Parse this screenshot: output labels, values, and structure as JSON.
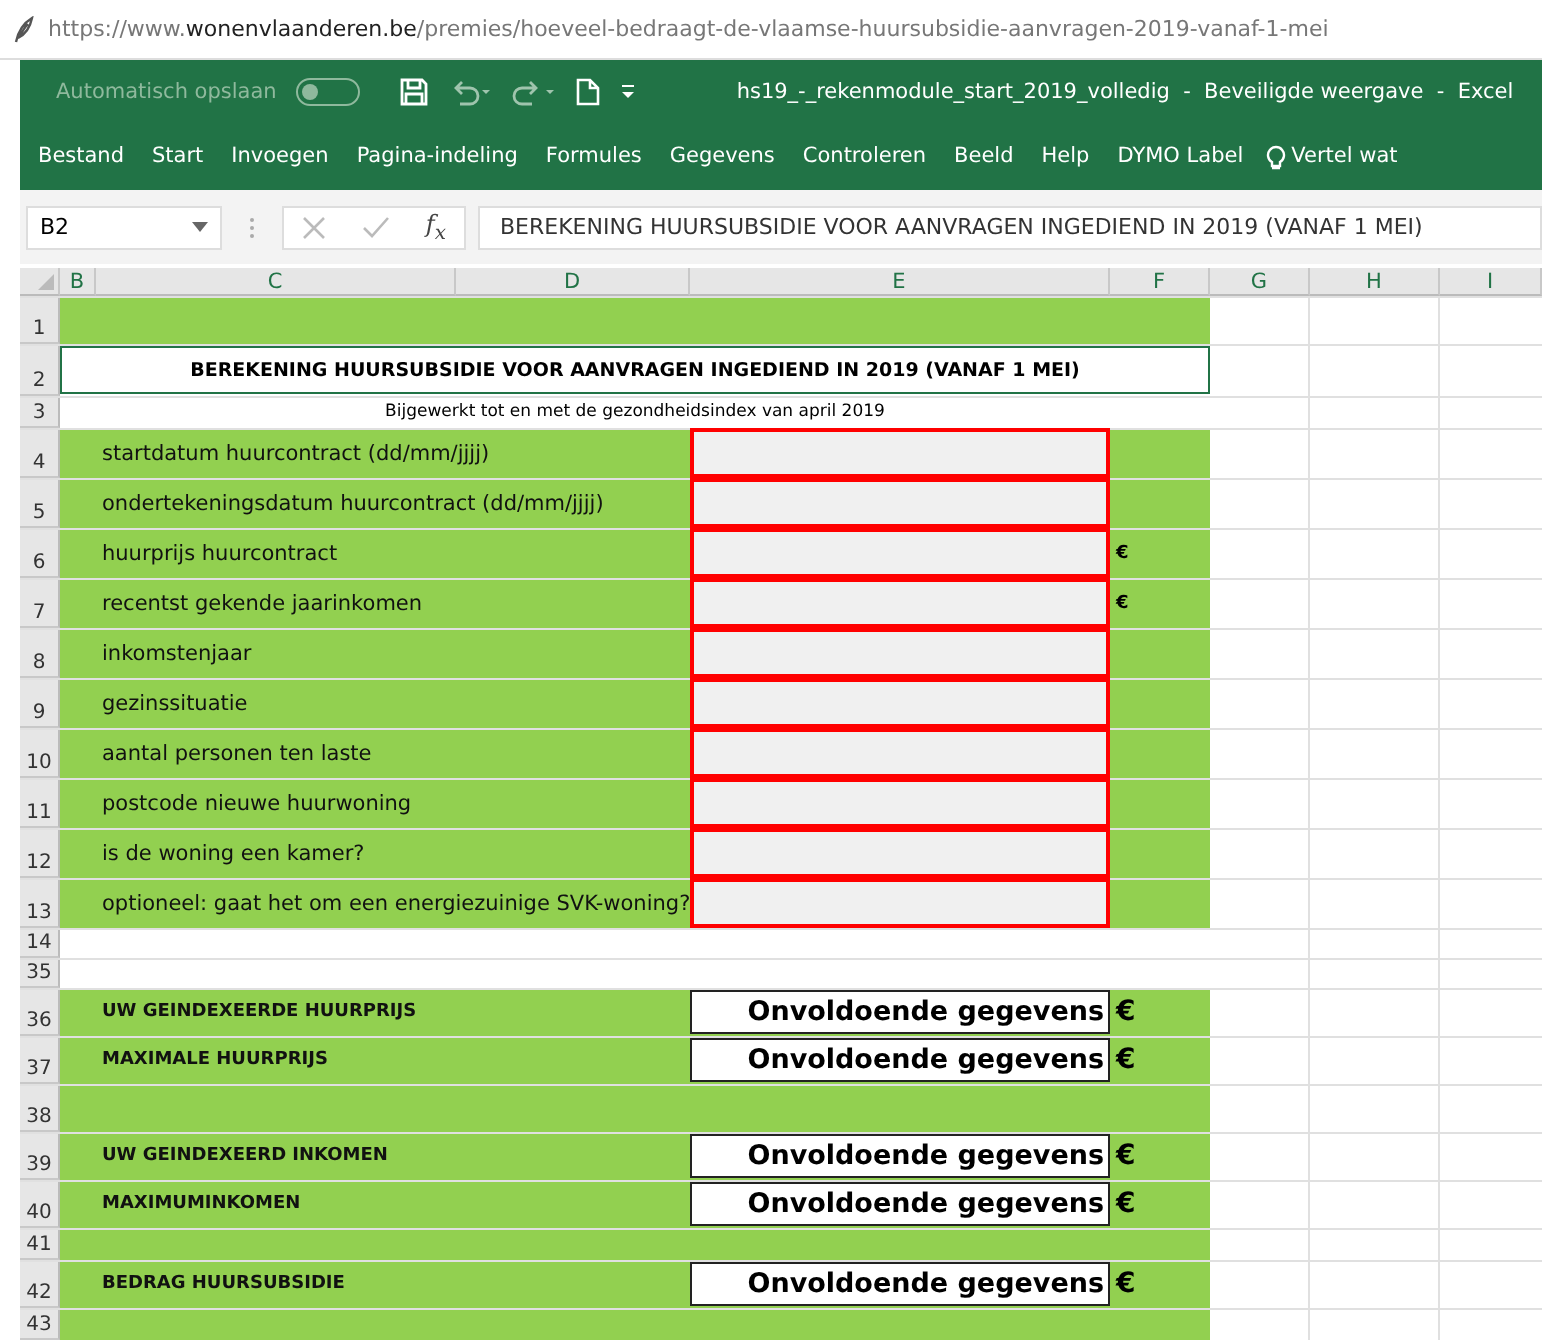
{
  "browser": {
    "url": "https://www.**wonenvlaanderen.be**/premies/hoeveel-bedraagt-de-vlaamse-huursubsidie-aanvragen-2019-vanaf-1-mei"
  },
  "excel": {
    "autosave_label": "Automatisch opslaan",
    "autosave_on": false,
    "title": "hs19_-_rekenmodule_start_2019_volledig  -  Beveiligde weergave  -  Excel",
    "menu": [
      "Bestand",
      "Start",
      "Invoegen",
      "Pagina-indeling",
      "Formules",
      "Gegevens",
      "Controleren",
      "Beeld",
      "Help",
      "DYMO Label"
    ],
    "tell_me": "Vertel wat"
  },
  "formula_bar": {
    "name_box": "B2",
    "fx": "f$_{x}$",
    "formula": "BEREKENING HUURSUBSIDIE VOOR AANVRAGEN INGEDIEND IN 2019 (VANAF 1 MEI)"
  },
  "columns": [
    "B",
    "C",
    "D",
    "E",
    "F",
    "G",
    "H",
    "I"
  ],
  "rows": [
    {
      "number": "1",
      "kind": "blank"
    },
    {
      "number": "2",
      "kind": "title",
      "text": "BEREKENING HUURSUBSIDIE VOOR AANVRAGEN INGEDIEND IN 2019 (VANAF 1 MEI)"
    },
    {
      "number": "3",
      "kind": "subtitle",
      "text": "Bijgewerkt tot en met de gezondheidsindex van april 2019"
    },
    {
      "number": "4",
      "kind": "input",
      "label": "startdatum huurcontract (dd/mm/jjjj)"
    },
    {
      "number": "5",
      "kind": "input",
      "label": "ondertekeningsdatum huurcontract (dd/mm/jjjj)"
    },
    {
      "number": "6",
      "kind": "input",
      "label": "huurprijs huurcontract",
      "unit": "€"
    },
    {
      "number": "7",
      "kind": "input",
      "label": "recentst gekende jaarinkomen",
      "unit": "€"
    },
    {
      "number": "8",
      "kind": "input",
      "label": "inkomstenjaar"
    },
    {
      "number": "9",
      "kind": "input",
      "label": "gezinssituatie"
    },
    {
      "number": "10",
      "kind": "input",
      "label": "aantal personen ten laste"
    },
    {
      "number": "11",
      "kind": "input",
      "label": "postcode nieuwe huurwoning"
    },
    {
      "number": "12",
      "kind": "input",
      "label": "is de woning een kamer?"
    },
    {
      "number": "13",
      "kind": "input",
      "label": "optioneel: gaat het om een energiezuinige SVK-woning?"
    },
    {
      "number": "14",
      "kind": "gap"
    },
    {
      "number": "35",
      "kind": "gap"
    },
    {
      "number": "36",
      "kind": "result",
      "label": "UW GEINDEXEERDE HUURPRIJS",
      "value": "Onvoldoende gegevens",
      "unit": "€"
    },
    {
      "number": "37",
      "kind": "result",
      "label": "MAXIMALE  HUURPRIJS",
      "value": "Onvoldoende gegevens",
      "unit": "€"
    },
    {
      "number": "38",
      "kind": "blank"
    },
    {
      "number": "39",
      "kind": "result",
      "label": "UW GEINDEXEERD INKOMEN",
      "value": "Onvoldoende gegevens",
      "unit": "€"
    },
    {
      "number": "40",
      "kind": "result",
      "label": "MAXIMUMINKOMEN",
      "value": "Onvoldoende gegevens",
      "unit": "€"
    },
    {
      "number": "41",
      "kind": "spacer"
    },
    {
      "number": "42",
      "kind": "result",
      "label": "BEDRAG HUURSUBSIDIE",
      "value": "Onvoldoende gegevens",
      "unit": "€"
    },
    {
      "number": "43",
      "kind": "spacer"
    }
  ]
}
